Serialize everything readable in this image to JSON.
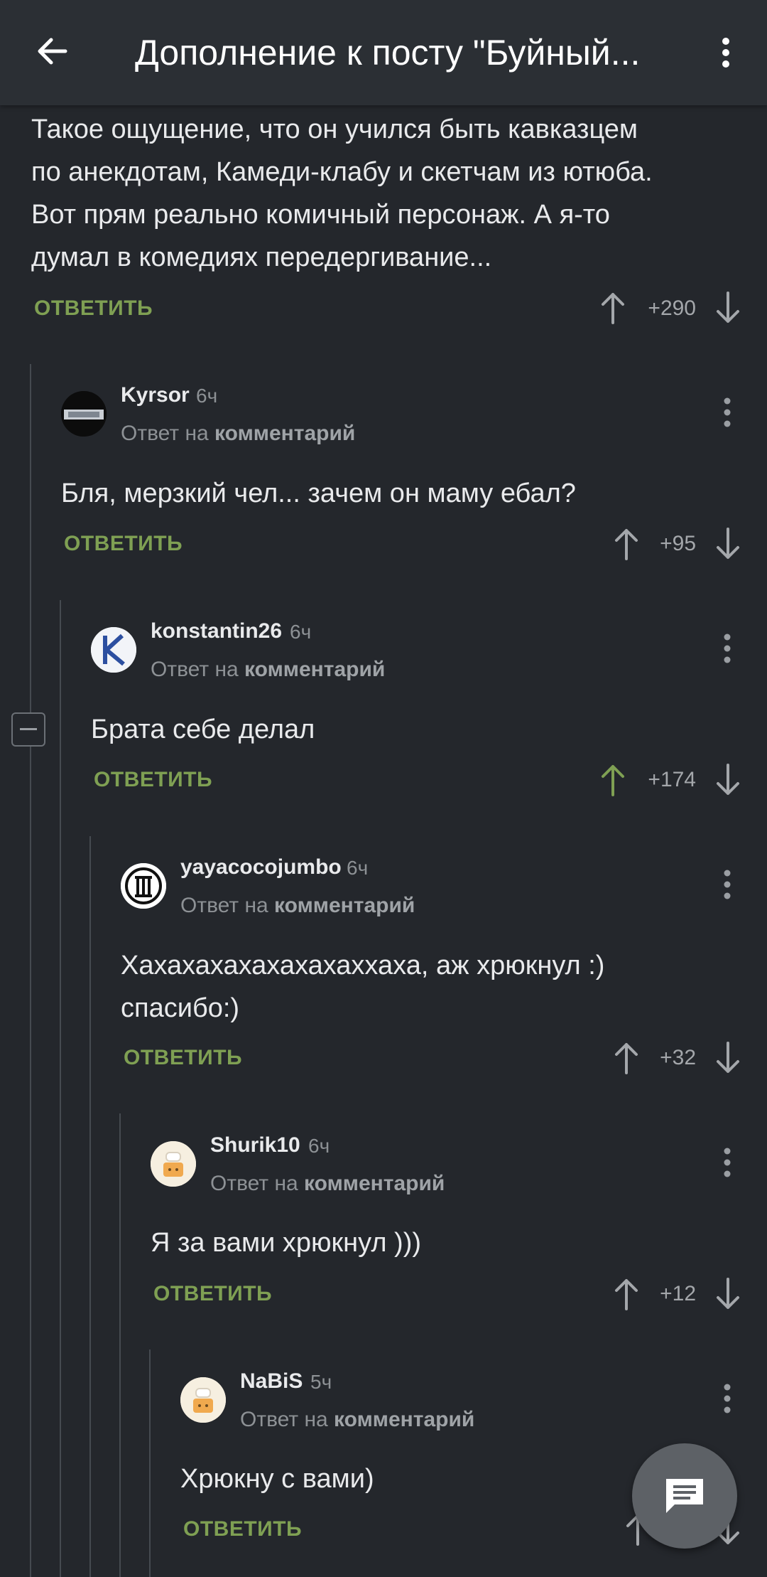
{
  "header": {
    "title": "Дополнение к посту \"Буйный...",
    "back_icon": "arrow-left-icon",
    "menu_icon": "more-vertical-icon"
  },
  "colors": {
    "background": "#24272c",
    "appbar": "#2b2f34",
    "accent_green": "#7fa053",
    "muted_text": "#8d9195"
  },
  "top_comment": {
    "lines": [
      "Такое ощущение, что он учился быть кавказцем",
      "по анекдотам, Камеди-клабу и скетчам из ютюба.",
      "Вот прям реально комичный персонаж. А я-то",
      "думал в комедиях передергивание..."
    ],
    "reply_label": "ОТВЕТИТЬ",
    "score": "+290"
  },
  "comments": [
    {
      "username": "Kyrsor",
      "time": "6ч",
      "reply_to_prefix": "Ответ на",
      "reply_to_link": "комментарий",
      "lines": [
        "Бля, мерзкий чел... зачем он маму ебал?"
      ],
      "reply_label": "ОТВЕТИТЬ",
      "score": "+95"
    },
    {
      "username": "konstantin26",
      "time": "6ч",
      "reply_to_prefix": "Ответ на",
      "reply_to_link": "комментарий",
      "lines": [
        "Брата себе делал"
      ],
      "reply_label": "ОТВЕТИТЬ",
      "score": "+174",
      "upvoted": true
    },
    {
      "username": "yayacocojumbo",
      "time": "6ч",
      "reply_to_prefix": "Ответ на",
      "reply_to_link": "комментарий",
      "lines": [
        "Хахахахахахахахаххаха, аж хрюкнул :)",
        "спасибо:)"
      ],
      "reply_label": "ОТВЕТИТЬ",
      "score": "+32"
    },
    {
      "username": "Shurik10",
      "time": "6ч",
      "reply_to_prefix": "Ответ на",
      "reply_to_link": "комментарий",
      "lines": [
        "Я за вами хрюкнул )))"
      ],
      "reply_label": "ОТВЕТИТЬ",
      "score": "+12"
    },
    {
      "username": "NaBiS",
      "time": "5ч",
      "reply_to_prefix": "Ответ на",
      "reply_to_link": "комментарий",
      "lines": [
        "Хрюкну с вами)"
      ],
      "reply_label": "ОТВЕТИТЬ",
      "score": ""
    }
  ],
  "fab": {
    "icon": "comment-icon"
  }
}
